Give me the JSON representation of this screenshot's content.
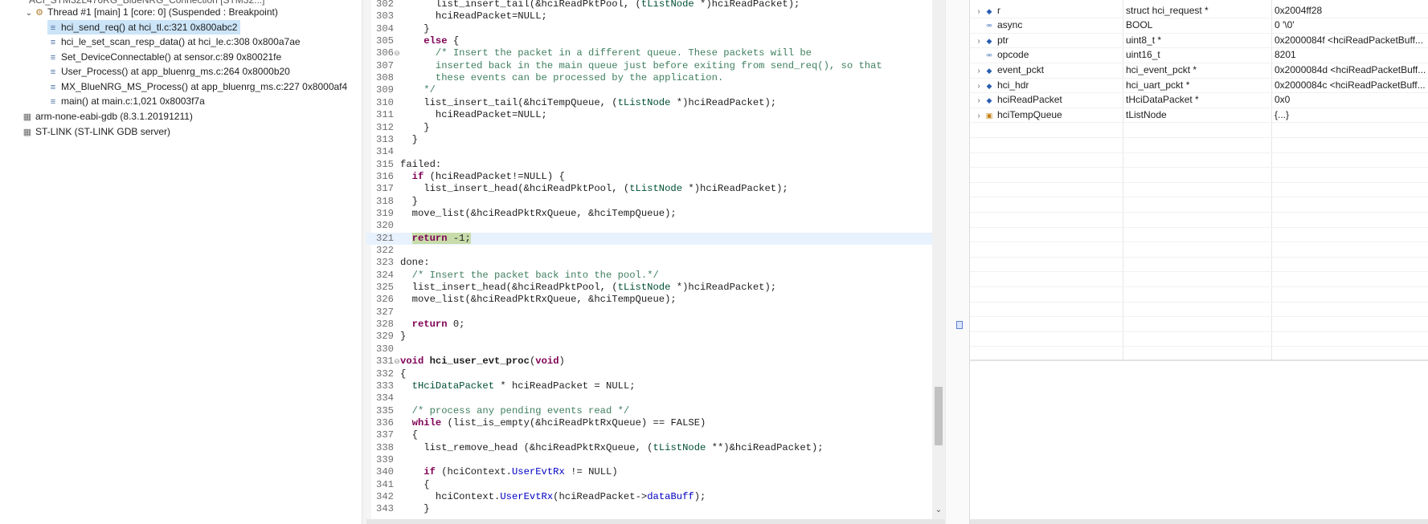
{
  "debug_tree": {
    "cut_row": "ACI_STM32L476RG_BlueNRG_Connection [STM32...]",
    "thread": {
      "label": "Thread #1 [main] 1 [core: 0] (Suspended : Breakpoint)",
      "frames": [
        {
          "label": "hci_send_req() at hci_tl.c:321 0x800abc2",
          "selected": true
        },
        {
          "label": "hci_le_set_scan_resp_data() at hci_le.c:308 0x800a7ae",
          "selected": false
        },
        {
          "label": "Set_DeviceConnectable() at sensor.c:89 0x80021fe",
          "selected": false
        },
        {
          "label": "User_Process() at app_bluenrg_ms.c:264 0x8000b20",
          "selected": false
        },
        {
          "label": "MX_BlueNRG_MS_Process() at app_bluenrg_ms.c:227 0x8000af4",
          "selected": false
        },
        {
          "label": "main() at main.c:1,021 0x8003f7a",
          "selected": false
        }
      ]
    },
    "gdb": "arm-none-eabi-gdb (8.3.1.20191211)",
    "server": "ST-LINK (ST-LINK GDB server)"
  },
  "editor": {
    "current_line": 321,
    "lines": [
      {
        "n": "302",
        "html": "      list_insert_tail(&amp;hciReadPktPool, (<span class=\"ty\">tListNode</span> *)hciReadPacket);"
      },
      {
        "n": "303",
        "html": "      hciReadPacket=NULL;"
      },
      {
        "n": "304",
        "html": "    }"
      },
      {
        "n": "305",
        "html": "    <span class=\"kw\">else</span> {"
      },
      {
        "n": "306",
        "fold": true,
        "html": "      <span class=\"cm\">/* Insert the packet in a different queue. These packets will be</span>"
      },
      {
        "n": "307",
        "html": "<span class=\"cm\">      inserted back in the main queue just before exiting from send_req(), so that</span>"
      },
      {
        "n": "308",
        "html": "<span class=\"cm\">      these events can be processed by the application.</span>"
      },
      {
        "n": "309",
        "html": "<span class=\"cm\">    */</span>"
      },
      {
        "n": "310",
        "html": "    list_insert_tail(&amp;hciTempQueue, (<span class=\"ty\">tListNode</span> *)hciReadPacket);"
      },
      {
        "n": "311",
        "html": "      hciReadPacket=NULL;"
      },
      {
        "n": "312",
        "html": "    }"
      },
      {
        "n": "313",
        "html": "  }"
      },
      {
        "n": "314",
        "html": ""
      },
      {
        "n": "315",
        "html": "failed:"
      },
      {
        "n": "316",
        "html": "  <span class=\"kw\">if</span> (hciReadPacket!=NULL) {"
      },
      {
        "n": "317",
        "html": "    list_insert_head(&amp;hciReadPktPool, (<span class=\"ty\">tListNode</span> *)hciReadPacket);"
      },
      {
        "n": "318",
        "html": "  }"
      },
      {
        "n": "319",
        "html": "  move_list(&amp;hciReadPktRxQueue, &amp;hciTempQueue);"
      },
      {
        "n": "320",
        "html": ""
      },
      {
        "n": "321",
        "current": true,
        "html": "  <span class=\"hl\"><span class=\"kw\">return</span> -1;</span>"
      },
      {
        "n": "322",
        "html": ""
      },
      {
        "n": "323",
        "html": "done:"
      },
      {
        "n": "324",
        "html": "  <span class=\"cm\">/* Insert the packet back into the pool.*/</span>"
      },
      {
        "n": "325",
        "html": "  list_insert_head(&amp;hciReadPktPool, (<span class=\"ty\">tListNode</span> *)hciReadPacket);"
      },
      {
        "n": "326",
        "html": "  move_list(&amp;hciReadPktRxQueue, &amp;hciTempQueue);"
      },
      {
        "n": "327",
        "html": ""
      },
      {
        "n": "328",
        "html": "  <span class=\"kw\">return</span> 0;"
      },
      {
        "n": "329",
        "html": "}"
      },
      {
        "n": "330",
        "html": ""
      },
      {
        "n": "331",
        "fold": true,
        "html": "<span class=\"kw\">void</span> <span class=\"fn\">hci_user_evt_proc</span>(<span class=\"kw\">void</span>)"
      },
      {
        "n": "332",
        "html": "{"
      },
      {
        "n": "333",
        "html": "  <span class=\"ty\">tHciDataPacket</span> * hciReadPacket = NULL;"
      },
      {
        "n": "334",
        "html": ""
      },
      {
        "n": "335",
        "html": "  <span class=\"cm\">/* process any pending events read */</span>"
      },
      {
        "n": "336",
        "html": "  <span class=\"kw\">while</span> (list_is_empty(&amp;hciReadPktRxQueue) == FALSE)"
      },
      {
        "n": "337",
        "html": "  {"
      },
      {
        "n": "338",
        "html": "    list_remove_head (&amp;hciReadPktRxQueue, (<span class=\"ty\">tListNode</span> **)&amp;hciReadPacket);"
      },
      {
        "n": "339",
        "html": ""
      },
      {
        "n": "340",
        "html": "    <span class=\"kw\">if</span> (hciContext.<span class=\"fld\">UserEvtRx</span> != NULL)"
      },
      {
        "n": "341",
        "html": "    {"
      },
      {
        "n": "342",
        "html": "      hciContext.<span class=\"fld\">UserEvtRx</span>(hciReadPacket-&gt;<span class=\"fld\">dataBuff</span>);"
      },
      {
        "n": "343",
        "html": "    }"
      }
    ]
  },
  "variables": {
    "rows": [
      {
        "name": "r",
        "type": "struct hci_request *",
        "value": "0x2004ff28",
        "expandable": true,
        "icon": "pointer-icon"
      },
      {
        "name": "async",
        "type": "BOOL",
        "value": "0 '\\0'",
        "expandable": false,
        "icon": "primitive-icon"
      },
      {
        "name": "ptr",
        "type": "uint8_t *",
        "value": "0x2000084f <hciReadPacketBuff...",
        "expandable": true,
        "icon": "pointer-icon"
      },
      {
        "name": "opcode",
        "type": "uint16_t",
        "value": "8201",
        "expandable": false,
        "icon": "primitive-icon"
      },
      {
        "name": "event_pckt",
        "type": "hci_event_pckt *",
        "value": "0x2000084d <hciReadPacketBuff...",
        "expandable": true,
        "icon": "pointer-icon"
      },
      {
        "name": "hci_hdr",
        "type": "hci_uart_pckt *",
        "value": "0x2000084c <hciReadPacketBuff...",
        "expandable": true,
        "icon": "pointer-icon"
      },
      {
        "name": "hciReadPacket",
        "type": "tHciDataPacket *",
        "value": "0x0",
        "expandable": true,
        "icon": "pointer-icon"
      },
      {
        "name": "hciTempQueue",
        "type": "tListNode",
        "value": "{...}",
        "expandable": true,
        "icon": "struct-icon"
      }
    ]
  }
}
